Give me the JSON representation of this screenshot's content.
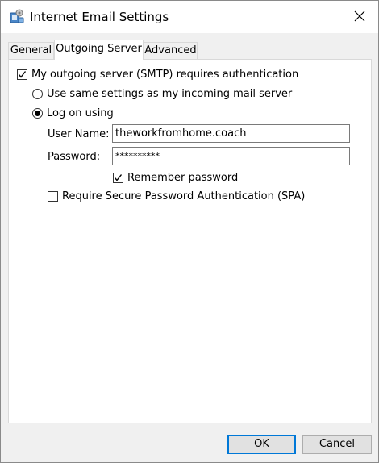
{
  "window": {
    "title": "Internet Email Settings",
    "icon": "outlook-mail-settings-icon",
    "close_icon": "close-icon"
  },
  "tabs": [
    {
      "label": "General",
      "active": false
    },
    {
      "label": "Outgoing Server",
      "active": true
    },
    {
      "label": "Advanced",
      "active": false
    }
  ],
  "outgoing": {
    "smtp_auth_label": "My outgoing server (SMTP) requires authentication",
    "smtp_auth_checked": true,
    "same_settings_label": "Use same settings as my incoming mail server",
    "same_settings_selected": false,
    "log_on_label": "Log on using",
    "log_on_selected": true,
    "username_label": "User Name:",
    "username_value": "theworkfromhome.coach",
    "password_label": "Password:",
    "password_value": "**********",
    "remember_label": "Remember password",
    "remember_checked": true,
    "spa_label": "Require Secure Password Authentication (SPA)",
    "spa_checked": false
  },
  "buttons": {
    "ok": "OK",
    "cancel": "Cancel"
  },
  "colors": {
    "accent": "#0078d7",
    "window_bg": "#f0f0f0",
    "panel_bg": "#ffffff"
  }
}
